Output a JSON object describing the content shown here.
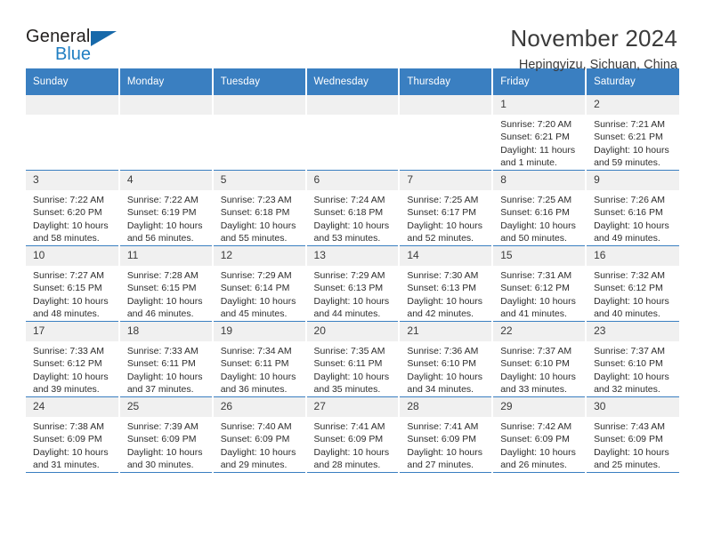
{
  "brand": {
    "name_part1": "General",
    "name_part2": "Blue",
    "accent_color": "#1769aa",
    "text_color": "#23201f"
  },
  "header": {
    "title": "November 2024",
    "subtitle": "Hepingyizu, Sichuan, China"
  },
  "calendar": {
    "header_bg": "#3a7fc1",
    "daynum_bg": "#f0f0f0",
    "weekdays": [
      "Sunday",
      "Monday",
      "Tuesday",
      "Wednesday",
      "Thursday",
      "Friday",
      "Saturday"
    ],
    "weeks": [
      [
        {
          "day": "",
          "sunrise": "",
          "sunset": "",
          "daylight1": "",
          "daylight2": ""
        },
        {
          "day": "",
          "sunrise": "",
          "sunset": "",
          "daylight1": "",
          "daylight2": ""
        },
        {
          "day": "",
          "sunrise": "",
          "sunset": "",
          "daylight1": "",
          "daylight2": ""
        },
        {
          "day": "",
          "sunrise": "",
          "sunset": "",
          "daylight1": "",
          "daylight2": ""
        },
        {
          "day": "",
          "sunrise": "",
          "sunset": "",
          "daylight1": "",
          "daylight2": ""
        },
        {
          "day": "1",
          "sunrise": "Sunrise: 7:20 AM",
          "sunset": "Sunset: 6:21 PM",
          "daylight1": "Daylight: 11 hours",
          "daylight2": "and 1 minute."
        },
        {
          "day": "2",
          "sunrise": "Sunrise: 7:21 AM",
          "sunset": "Sunset: 6:21 PM",
          "daylight1": "Daylight: 10 hours",
          "daylight2": "and 59 minutes."
        }
      ],
      [
        {
          "day": "3",
          "sunrise": "Sunrise: 7:22 AM",
          "sunset": "Sunset: 6:20 PM",
          "daylight1": "Daylight: 10 hours",
          "daylight2": "and 58 minutes."
        },
        {
          "day": "4",
          "sunrise": "Sunrise: 7:22 AM",
          "sunset": "Sunset: 6:19 PM",
          "daylight1": "Daylight: 10 hours",
          "daylight2": "and 56 minutes."
        },
        {
          "day": "5",
          "sunrise": "Sunrise: 7:23 AM",
          "sunset": "Sunset: 6:18 PM",
          "daylight1": "Daylight: 10 hours",
          "daylight2": "and 55 minutes."
        },
        {
          "day": "6",
          "sunrise": "Sunrise: 7:24 AM",
          "sunset": "Sunset: 6:18 PM",
          "daylight1": "Daylight: 10 hours",
          "daylight2": "and 53 minutes."
        },
        {
          "day": "7",
          "sunrise": "Sunrise: 7:25 AM",
          "sunset": "Sunset: 6:17 PM",
          "daylight1": "Daylight: 10 hours",
          "daylight2": "and 52 minutes."
        },
        {
          "day": "8",
          "sunrise": "Sunrise: 7:25 AM",
          "sunset": "Sunset: 6:16 PM",
          "daylight1": "Daylight: 10 hours",
          "daylight2": "and 50 minutes."
        },
        {
          "day": "9",
          "sunrise": "Sunrise: 7:26 AM",
          "sunset": "Sunset: 6:16 PM",
          "daylight1": "Daylight: 10 hours",
          "daylight2": "and 49 minutes."
        }
      ],
      [
        {
          "day": "10",
          "sunrise": "Sunrise: 7:27 AM",
          "sunset": "Sunset: 6:15 PM",
          "daylight1": "Daylight: 10 hours",
          "daylight2": "and 48 minutes."
        },
        {
          "day": "11",
          "sunrise": "Sunrise: 7:28 AM",
          "sunset": "Sunset: 6:15 PM",
          "daylight1": "Daylight: 10 hours",
          "daylight2": "and 46 minutes."
        },
        {
          "day": "12",
          "sunrise": "Sunrise: 7:29 AM",
          "sunset": "Sunset: 6:14 PM",
          "daylight1": "Daylight: 10 hours",
          "daylight2": "and 45 minutes."
        },
        {
          "day": "13",
          "sunrise": "Sunrise: 7:29 AM",
          "sunset": "Sunset: 6:13 PM",
          "daylight1": "Daylight: 10 hours",
          "daylight2": "and 44 minutes."
        },
        {
          "day": "14",
          "sunrise": "Sunrise: 7:30 AM",
          "sunset": "Sunset: 6:13 PM",
          "daylight1": "Daylight: 10 hours",
          "daylight2": "and 42 minutes."
        },
        {
          "day": "15",
          "sunrise": "Sunrise: 7:31 AM",
          "sunset": "Sunset: 6:12 PM",
          "daylight1": "Daylight: 10 hours",
          "daylight2": "and 41 minutes."
        },
        {
          "day": "16",
          "sunrise": "Sunrise: 7:32 AM",
          "sunset": "Sunset: 6:12 PM",
          "daylight1": "Daylight: 10 hours",
          "daylight2": "and 40 minutes."
        }
      ],
      [
        {
          "day": "17",
          "sunrise": "Sunrise: 7:33 AM",
          "sunset": "Sunset: 6:12 PM",
          "daylight1": "Daylight: 10 hours",
          "daylight2": "and 39 minutes."
        },
        {
          "day": "18",
          "sunrise": "Sunrise: 7:33 AM",
          "sunset": "Sunset: 6:11 PM",
          "daylight1": "Daylight: 10 hours",
          "daylight2": "and 37 minutes."
        },
        {
          "day": "19",
          "sunrise": "Sunrise: 7:34 AM",
          "sunset": "Sunset: 6:11 PM",
          "daylight1": "Daylight: 10 hours",
          "daylight2": "and 36 minutes."
        },
        {
          "day": "20",
          "sunrise": "Sunrise: 7:35 AM",
          "sunset": "Sunset: 6:11 PM",
          "daylight1": "Daylight: 10 hours",
          "daylight2": "and 35 minutes."
        },
        {
          "day": "21",
          "sunrise": "Sunrise: 7:36 AM",
          "sunset": "Sunset: 6:10 PM",
          "daylight1": "Daylight: 10 hours",
          "daylight2": "and 34 minutes."
        },
        {
          "day": "22",
          "sunrise": "Sunrise: 7:37 AM",
          "sunset": "Sunset: 6:10 PM",
          "daylight1": "Daylight: 10 hours",
          "daylight2": "and 33 minutes."
        },
        {
          "day": "23",
          "sunrise": "Sunrise: 7:37 AM",
          "sunset": "Sunset: 6:10 PM",
          "daylight1": "Daylight: 10 hours",
          "daylight2": "and 32 minutes."
        }
      ],
      [
        {
          "day": "24",
          "sunrise": "Sunrise: 7:38 AM",
          "sunset": "Sunset: 6:09 PM",
          "daylight1": "Daylight: 10 hours",
          "daylight2": "and 31 minutes."
        },
        {
          "day": "25",
          "sunrise": "Sunrise: 7:39 AM",
          "sunset": "Sunset: 6:09 PM",
          "daylight1": "Daylight: 10 hours",
          "daylight2": "and 30 minutes."
        },
        {
          "day": "26",
          "sunrise": "Sunrise: 7:40 AM",
          "sunset": "Sunset: 6:09 PM",
          "daylight1": "Daylight: 10 hours",
          "daylight2": "and 29 minutes."
        },
        {
          "day": "27",
          "sunrise": "Sunrise: 7:41 AM",
          "sunset": "Sunset: 6:09 PM",
          "daylight1": "Daylight: 10 hours",
          "daylight2": "and 28 minutes."
        },
        {
          "day": "28",
          "sunrise": "Sunrise: 7:41 AM",
          "sunset": "Sunset: 6:09 PM",
          "daylight1": "Daylight: 10 hours",
          "daylight2": "and 27 minutes."
        },
        {
          "day": "29",
          "sunrise": "Sunrise: 7:42 AM",
          "sunset": "Sunset: 6:09 PM",
          "daylight1": "Daylight: 10 hours",
          "daylight2": "and 26 minutes."
        },
        {
          "day": "30",
          "sunrise": "Sunrise: 7:43 AM",
          "sunset": "Sunset: 6:09 PM",
          "daylight1": "Daylight: 10 hours",
          "daylight2": "and 25 minutes."
        }
      ]
    ]
  }
}
